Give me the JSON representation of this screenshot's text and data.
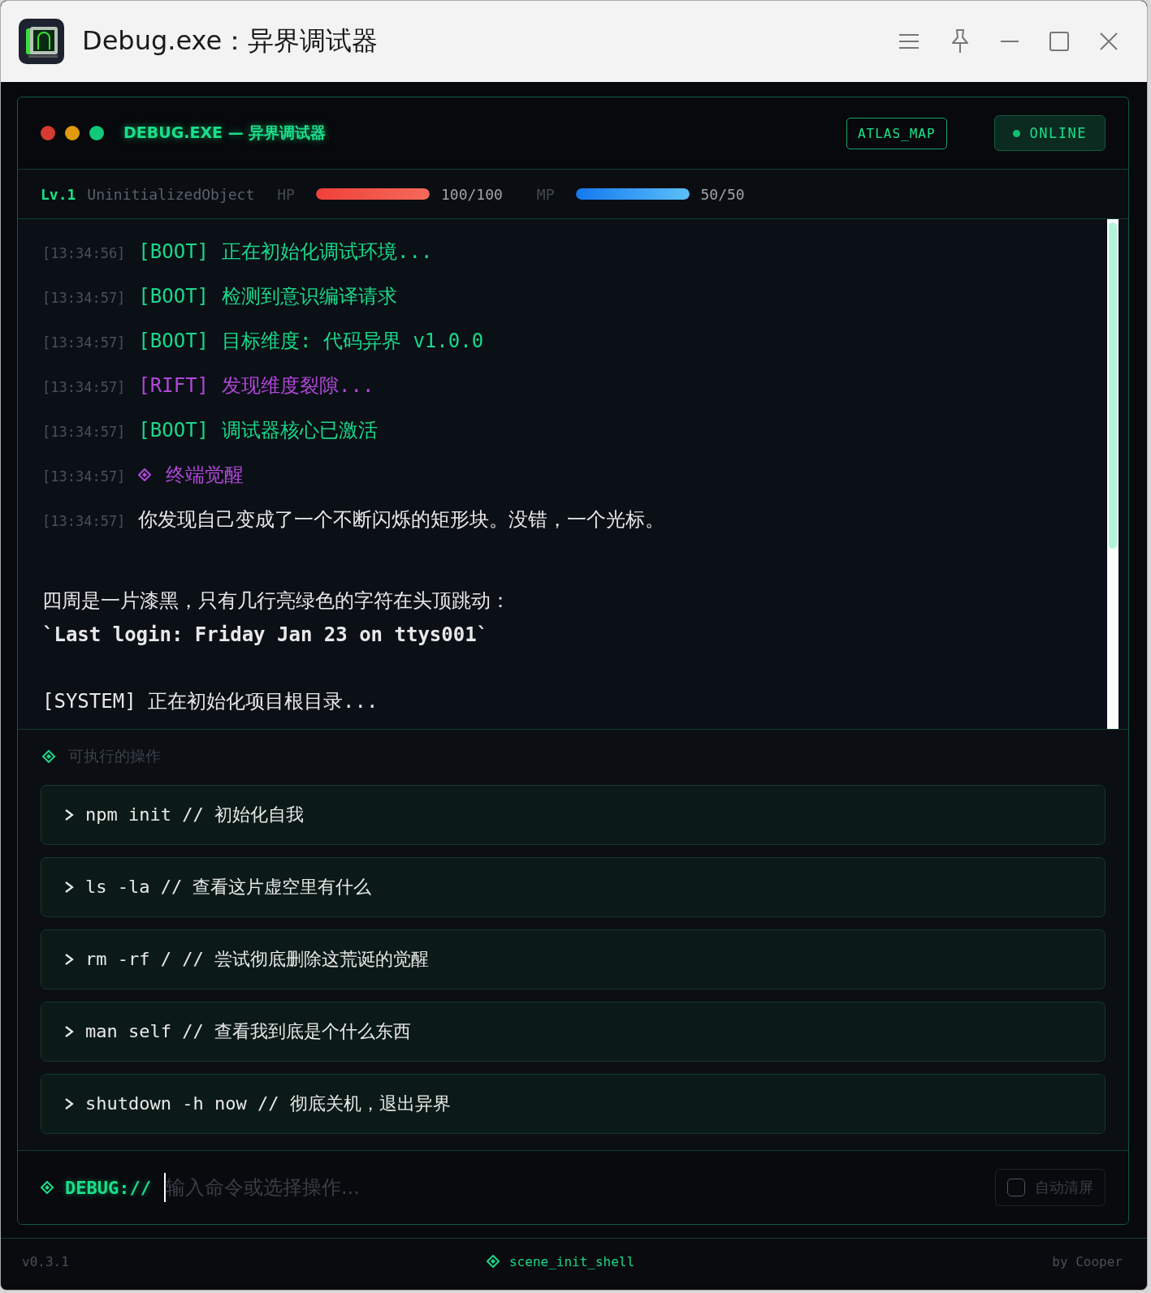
{
  "window": {
    "title": "Debug.exe：异界调试器"
  },
  "panel": {
    "title": "DEBUG.EXE — 异界调试器",
    "map_button": "ATLAS_MAP",
    "status": "ONLINE"
  },
  "stats": {
    "level": "Lv.1",
    "name": "UninitializedObject",
    "hp": {
      "label": "HP",
      "level": 1,
      "reading": "100/100"
    },
    "mp": {
      "label": "MP",
      "level": 1,
      "reading": "50/50"
    }
  },
  "log": [
    {
      "kind": "boot",
      "time": "[13:34:56]",
      "tag": "[BOOT]",
      "text": "正在初始化调试环境..."
    },
    {
      "kind": "boot",
      "time": "[13:34:57]",
      "tag": "[BOOT]",
      "text": "检测到意识编译请求"
    },
    {
      "kind": "boot",
      "time": "[13:34:57]",
      "tag": "[BOOT]",
      "text": "目标维度: 代码异界 v1.0.0"
    },
    {
      "kind": "rift",
      "time": "[13:34:57]",
      "tag": "[RIFT]",
      "text": "发现维度裂隙..."
    },
    {
      "kind": "boot",
      "time": "[13:34:57]",
      "tag": "[BOOT]",
      "text": "调试器核心已激活"
    },
    {
      "kind": "event",
      "time": "[13:34:57]",
      "text": "终端觉醒"
    },
    {
      "kind": "story",
      "time": "[13:34:57]",
      "text": "你发现自己变成了一个不断闪烁的矩形块。没错，一个光标。"
    }
  ],
  "narrative": [
    {
      "kind": "text",
      "text": "四周是一片漆黑，只有几行亮绿色的字符在头顶跳动："
    },
    {
      "kind": "code",
      "text": "`Last login: Friday Jan 23 on ttys001`"
    },
    {
      "kind": "gap"
    },
    {
      "kind": "system",
      "tag": "[SYSTEM]",
      "text": "正在初始化项目根目录..."
    }
  ],
  "actions": {
    "heading": "可执行的操作",
    "items": [
      {
        "text": "npm init // 初始化自我"
      },
      {
        "text": "ls -la // 查看这片虚空里有什么"
      },
      {
        "text": "rm -rf / // 尝试彻底删除这荒诞的觉醒"
      },
      {
        "text": "man self // 查看我到底是个什么东西"
      },
      {
        "text": "shutdown -h now // 彻底关机，退出异界"
      }
    ]
  },
  "input": {
    "prompt": "DEBUG://",
    "placeholder": "输入命令或选择操作...",
    "auto_clear": {
      "label": "自动清屏",
      "checked": false
    }
  },
  "footer": {
    "version": "v0.3.1",
    "scene": "scene_init_shell",
    "author": "by Cooper"
  }
}
